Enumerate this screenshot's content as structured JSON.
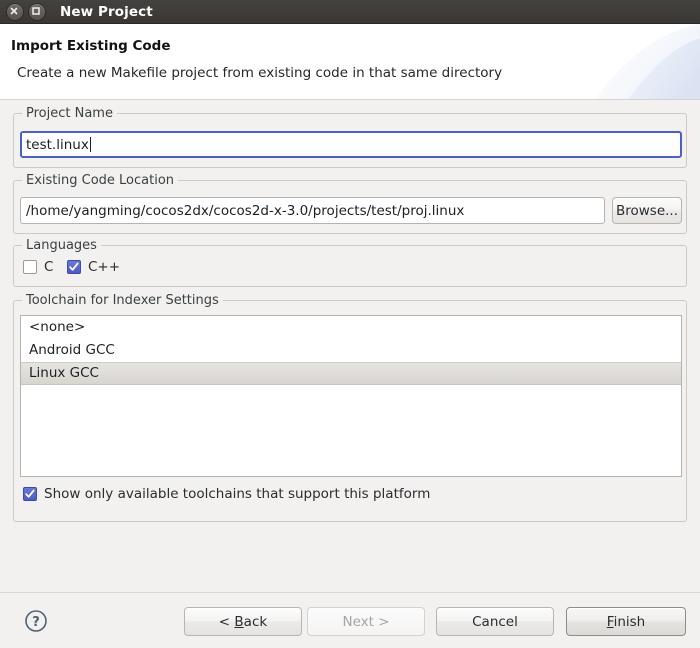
{
  "window": {
    "title": "New Project",
    "close_icon": "close-icon",
    "maximize_icon": "maximize-icon"
  },
  "header": {
    "title": "Import Existing Code",
    "description": "Create a new Makefile project from existing code in that same directory"
  },
  "project_name": {
    "group_label": "Project Name",
    "value": "test.linux",
    "placeholder": ""
  },
  "code_location": {
    "group_label": "Existing Code Location",
    "value": "/home/yangming/cocos2dx/cocos2d-x-3.0/projects/test/proj.linux",
    "placeholder": "",
    "browse_label": "Browse..."
  },
  "languages": {
    "group_label": "Languages",
    "options": [
      {
        "label": "C",
        "checked": false
      },
      {
        "label": "C++",
        "checked": true
      }
    ]
  },
  "toolchain": {
    "group_label": "Toolchain for Indexer Settings",
    "items": [
      {
        "label": "<none>",
        "selected": false
      },
      {
        "label": "Android GCC",
        "selected": false
      },
      {
        "label": "Linux GCC",
        "selected": true
      }
    ],
    "show_only_available": {
      "label": "Show only available toolchains that support this platform",
      "checked": true
    }
  },
  "footer": {
    "help_icon": "help-icon",
    "buttons": [
      {
        "name": "back",
        "label": "< Back",
        "mnemonic": "B",
        "state": "enabled"
      },
      {
        "name": "next",
        "label": "Next >",
        "mnemonic": "",
        "state": "disabled"
      },
      {
        "name": "cancel",
        "label": "Cancel",
        "mnemonic": "",
        "state": "enabled"
      },
      {
        "name": "finish",
        "label": "Finish",
        "mnemonic": "F",
        "state": "default"
      }
    ]
  },
  "colors": {
    "titlebar": "#3a3734",
    "dialog_bg": "#f2f1f0",
    "focus_border": "#4a62c4",
    "checkbox_checked": "#4c5cc4",
    "selection": "#d8d5d1",
    "banner": "#dfe5f2"
  }
}
